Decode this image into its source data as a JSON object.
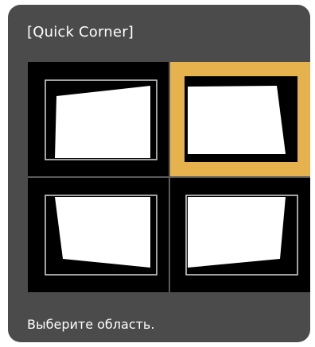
{
  "dialog": {
    "title": "[Quick Corner]",
    "status_text": "Выберите область."
  },
  "corners": [
    {
      "name": "top-left",
      "selected": false
    },
    {
      "name": "top-right",
      "selected": true
    },
    {
      "name": "bottom-left",
      "selected": false
    },
    {
      "name": "bottom-right",
      "selected": false
    }
  ],
  "colors": {
    "panel_background": "#4b4b4b",
    "selection_highlight": "#e6b24d",
    "shape_fill": "#ffffff",
    "outline": "#d8d8d8",
    "grid_background": "#000000"
  }
}
